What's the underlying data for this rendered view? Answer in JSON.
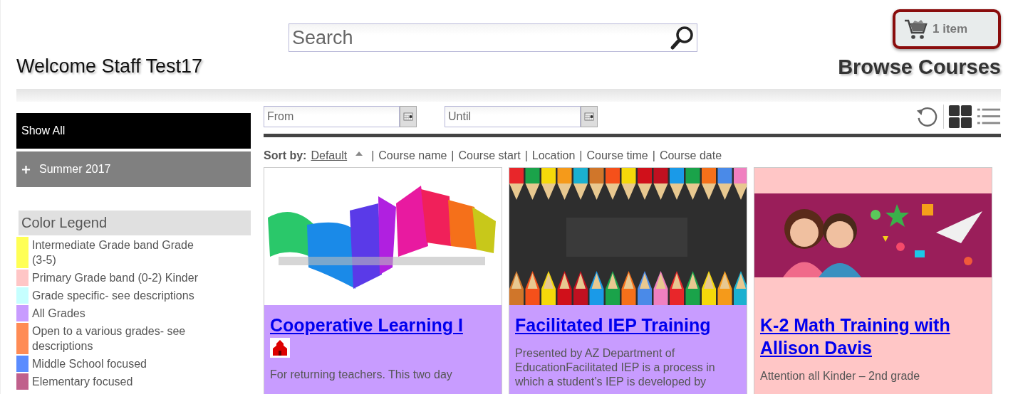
{
  "search": {
    "placeholder": "Search"
  },
  "cart": {
    "label": "1 item"
  },
  "welcome": "Welcome Staff Test17",
  "page_title": "Browse Courses",
  "sidebar": {
    "items": [
      {
        "kind": "all",
        "label": "Show All",
        "selected": true
      },
      {
        "kind": "group",
        "label": "Summer 2017",
        "selected": false
      }
    ]
  },
  "legend": {
    "title": "Color Legend",
    "items": [
      {
        "label": "Intermediate Grade band Grade (3-5)",
        "color": "#ffff55"
      },
      {
        "label": "Primary Grade band (0-2) Kinder",
        "color": "#ffc6c6"
      },
      {
        "label": "Grade specific- see descriptions",
        "color": "#c6ffff"
      },
      {
        "label": "All Grades",
        "color": "#c89cff"
      },
      {
        "label": "Open to a various grades- see descriptions",
        "color": "#ff8c55"
      },
      {
        "label": "Middle School focused",
        "color": "#5a8cff"
      },
      {
        "label": "Elementary focused",
        "color": "#c0608c"
      }
    ]
  },
  "filters": {
    "from": {
      "placeholder": "From"
    },
    "until": {
      "placeholder": "Until"
    }
  },
  "views": [
    {
      "kind": "grid",
      "selected": true
    },
    {
      "kind": "list",
      "selected": false
    }
  ],
  "sort": {
    "label": "Sort by:",
    "separator": "|",
    "options": [
      {
        "label": "Default",
        "selected": true
      },
      {
        "label": "Course name",
        "selected": false
      },
      {
        "label": "Course start",
        "selected": false
      },
      {
        "label": "Location",
        "selected": false
      },
      {
        "label": "Course time",
        "selected": false
      },
      {
        "label": "Course date",
        "selected": false
      }
    ]
  },
  "courses": [
    {
      "title": "Cooperative Learning I",
      "color": "#c89cff",
      "school_icon": true,
      "description": "For returning teachers. This two day"
    },
    {
      "title": "Facilitated IEP Training",
      "color": "#c89cff",
      "school_icon": false,
      "description": "Presented by AZ Department of EducationFacilitated IEP is a process in which a student’s IEP is developed by"
    },
    {
      "title": "K-2 Math Training with Allison Davis",
      "color": "#ffc6c6",
      "school_icon": false,
      "description": "Attention all Kinder – 2nd grade"
    }
  ]
}
